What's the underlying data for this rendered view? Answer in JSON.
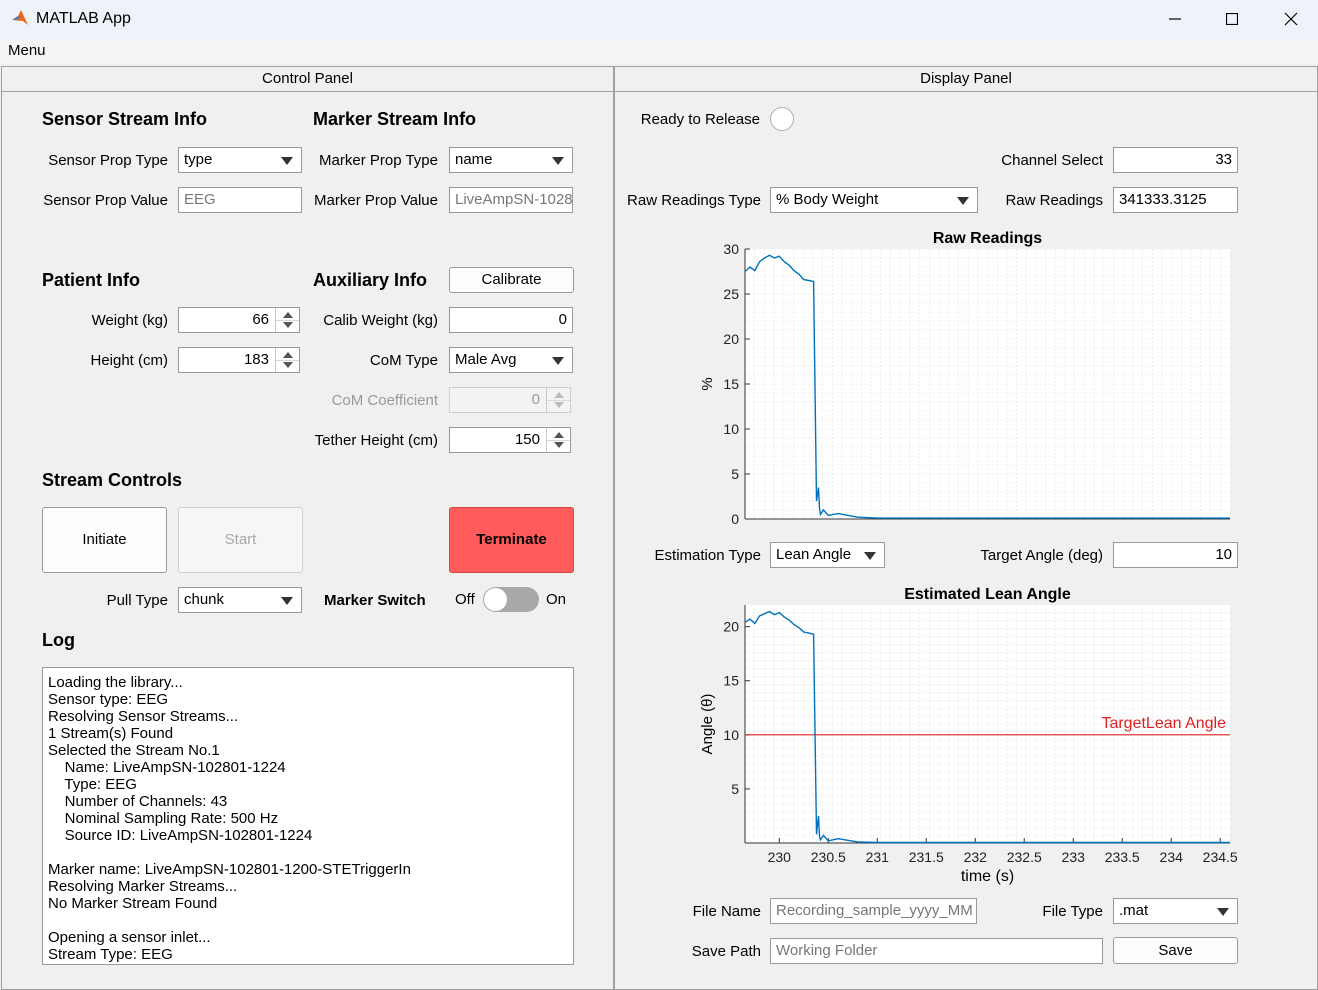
{
  "window": {
    "title": "MATLAB App",
    "menu": "Menu"
  },
  "control_panel": {
    "title": "Control Panel",
    "sensor_stream": {
      "heading": "Sensor Stream Info",
      "prop_type_label": "Sensor Prop Type",
      "prop_type_value": "type",
      "prop_value_label": "Sensor Prop Value",
      "prop_value_value": "EEG"
    },
    "marker_stream": {
      "heading": "Marker Stream Info",
      "prop_type_label": "Marker Prop Type",
      "prop_type_value": "name",
      "prop_value_label": "Marker Prop Value",
      "prop_value_value": "LiveAmpSN-1028"
    },
    "patient": {
      "heading": "Patient Info",
      "weight_label": "Weight (kg)",
      "weight_value": "66",
      "height_label": "Height (cm)",
      "height_value": "183"
    },
    "auxiliary": {
      "heading": "Auxiliary Info",
      "calibrate_label": "Calibrate",
      "calib_weight_label": "Calib Weight (kg)",
      "calib_weight_value": "0",
      "com_type_label": "CoM Type",
      "com_type_value": "Male Avg",
      "com_coeff_label": "CoM Coefficient",
      "com_coeff_value": "0",
      "tether_label": "Tether Height (cm)",
      "tether_value": "150"
    },
    "stream_controls": {
      "heading": "Stream Controls",
      "initiate": "Initiate",
      "start": "Start",
      "terminate": "Terminate",
      "pull_type_label": "Pull Type",
      "pull_type_value": "chunk",
      "marker_switch_label": "Marker Switch",
      "switch_off": "Off",
      "switch_on": "On",
      "marker_switch_on": false
    },
    "log": {
      "heading": "Log",
      "lines": [
        "Loading the library...",
        "Sensor type: EEG",
        "Resolving Sensor Streams...",
        "1 Stream(s) Found",
        "Selected the Stream No.1",
        "    Name: LiveAmpSN-102801-1224",
        "    Type: EEG",
        "    Number of Channels: 43",
        "    Nominal Sampling Rate: 500 Hz",
        "    Source ID: LiveAmpSN-102801-1224",
        "",
        "Marker name: LiveAmpSN-102801-1200-STETriggerIn",
        "Resolving Marker Streams...",
        "No Marker Stream Found",
        "",
        "Opening a sensor inlet...",
        "Stream Type: EEG"
      ]
    }
  },
  "display_panel": {
    "title": "Display Panel",
    "ready_label": "Ready to Release",
    "channel_select_label": "Channel Select",
    "channel_select_value": "33",
    "raw_type_label": "Raw Readings Type",
    "raw_type_value": "% Body Weight",
    "raw_readings_label": "Raw Readings",
    "raw_readings_value": "341333.3125",
    "estimation_type_label": "Estimation Type",
    "estimation_type_value": "Lean Angle",
    "target_angle_label": "Target Angle (deg)",
    "target_angle_value": "10",
    "file_name_label": "File Name",
    "file_name_placeholder": "Recording_sample_yyyy_MM",
    "file_type_label": "File Type",
    "file_type_value": ".mat",
    "save_path_label": "Save Path",
    "save_path_placeholder": "Working Folder",
    "save_label": "Save"
  },
  "chart_data": [
    {
      "type": "line",
      "title": "Raw Readings",
      "xlabel": "",
      "ylabel": "%",
      "xlim": [
        229.65,
        234.6
      ],
      "ylim": [
        0,
        30
      ],
      "yticks": [
        0,
        5,
        10,
        15,
        20,
        25,
        30
      ],
      "grid": true,
      "color": "#0072bd",
      "x": [
        229.65,
        229.7,
        229.75,
        229.8,
        229.85,
        229.9,
        229.95,
        230.0,
        230.05,
        230.1,
        230.15,
        230.2,
        230.25,
        230.3,
        230.35,
        230.38,
        230.4,
        230.41,
        230.42,
        230.45,
        230.5,
        230.6,
        230.8,
        231.0,
        232.0,
        233.0,
        234.0,
        234.6
      ],
      "y": [
        27.5,
        28.0,
        27.6,
        28.6,
        29.0,
        29.3,
        29.0,
        29.2,
        28.6,
        28.2,
        27.6,
        27.2,
        26.6,
        26.5,
        26.4,
        2.0,
        3.5,
        1.2,
        0.5,
        1.0,
        0.4,
        0.6,
        0.2,
        0.1,
        0.1,
        0.1,
        0.1,
        0.1
      ]
    },
    {
      "type": "line",
      "title": "Estimated Lean Angle",
      "xlabel": "time (s)",
      "ylabel": "Angle  (θ)",
      "xlim": [
        229.65,
        234.6
      ],
      "ylim": [
        0,
        22
      ],
      "xticks": [
        230,
        230.5,
        231,
        231.5,
        232,
        232.5,
        233,
        233.5,
        234,
        234.5
      ],
      "yticks": [
        5,
        10,
        15,
        20
      ],
      "grid": true,
      "color": "#0072bd",
      "reference_line": {
        "y": 10,
        "label": "TargetLean Angle",
        "color": "#e02020"
      },
      "x": [
        229.65,
        229.7,
        229.75,
        229.8,
        229.85,
        229.9,
        229.95,
        230.0,
        230.05,
        230.1,
        230.15,
        230.2,
        230.25,
        230.3,
        230.35,
        230.38,
        230.4,
        230.41,
        230.42,
        230.45,
        230.5,
        230.6,
        230.8,
        231.0,
        232.0,
        233.0,
        234.0,
        234.6
      ],
      "y": [
        20.4,
        20.7,
        20.3,
        21.0,
        21.2,
        21.4,
        21.1,
        21.3,
        20.9,
        20.6,
        20.2,
        19.9,
        19.5,
        19.4,
        19.3,
        0.8,
        2.5,
        0.6,
        0.3,
        0.7,
        0.2,
        0.4,
        0.1,
        0.05,
        0.05,
        0.05,
        0.05,
        0.05
      ]
    }
  ]
}
